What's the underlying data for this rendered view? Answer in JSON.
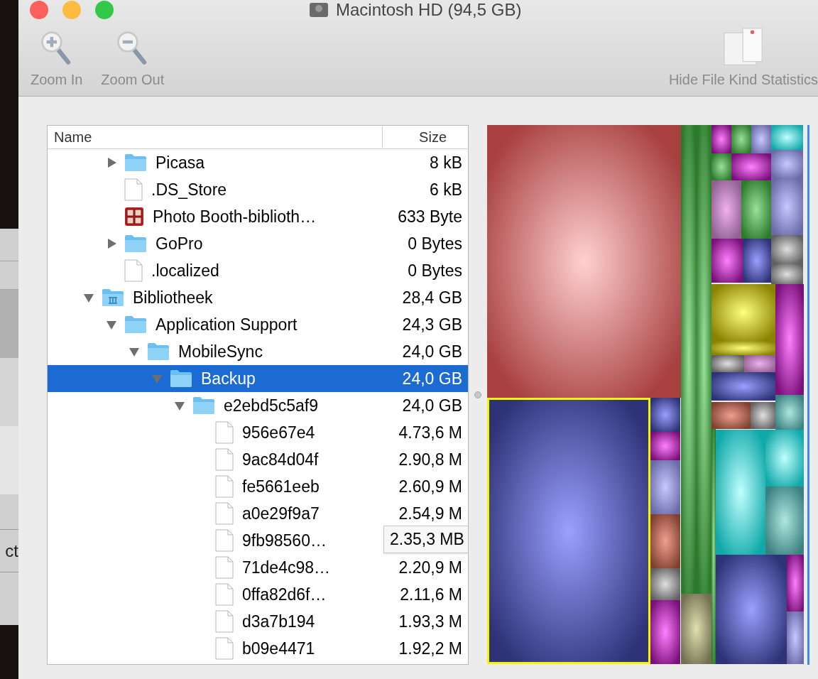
{
  "window": {
    "title": "Macintosh HD (94,5 GB)"
  },
  "background_window": {
    "text": "ct"
  },
  "toolbar": {
    "items": [
      {
        "kind": "zoom-in",
        "label": "Zoom In"
      },
      {
        "kind": "zoom-out",
        "label": "Zoom Out"
      }
    ],
    "right_item": {
      "label": "Hide File Kind Statistics"
    }
  },
  "table": {
    "columns": [
      "Name",
      "Size"
    ],
    "tree": [
      {
        "children": [
          {
            "name": "Picasa",
            "size": "8 kB",
            "kind": "folder",
            "expanded": false,
            "selected": false
          },
          {
            "name": ".DS_Store",
            "size": "6 kB",
            "kind": "document",
            "selected": false
          },
          {
            "name": "Photo Booth-biblioth…",
            "size": "633 Byte",
            "kind": "photo-library",
            "selected": false
          },
          {
            "name": "GoPro",
            "size": "0 Bytes",
            "kind": "folder",
            "expanded": false,
            "selected": false
          },
          {
            "name": ".localized",
            "size": "0 Bytes",
            "kind": "document",
            "selected": false
          }
        ]
      },
      {
        "name": "Bibliotheek",
        "size": "28,4 GB",
        "kind": "library-folder",
        "expanded": true,
        "selected": false,
        "children": [
          {
            "name": "Application Support",
            "size": "24,3 GB",
            "kind": "folder",
            "expanded": true,
            "selected": false,
            "children": [
              {
                "name": "MobileSync",
                "size": "24,0 GB",
                "kind": "folder",
                "expanded": true,
                "selected": false,
                "children": [
                  {
                    "name": "Backup",
                    "size": "24,0 GB",
                    "kind": "folder",
                    "expanded": true,
                    "selected": true,
                    "children": [
                      {
                        "name": "e2ebd5c5af9",
                        "size": "24,0 GB",
                        "kind": "folder",
                        "expanded": true,
                        "selected": false,
                        "children": [
                          {
                            "name": "956e67e4",
                            "size": "4.73,6 M",
                            "kind": "document",
                            "selected": false
                          },
                          {
                            "name": "9ac84d04f",
                            "size": "2.90,8 M",
                            "kind": "document",
                            "selected": false
                          },
                          {
                            "name": "fe5661eeb",
                            "size": "2.60,9 M",
                            "kind": "document",
                            "selected": false
                          },
                          {
                            "name": "a0e29f9a7",
                            "size": "2.54,9 M",
                            "kind": "document",
                            "selected": false
                          },
                          {
                            "name": "9fb98560…",
                            "tooltip": "2.35,3 MB",
                            "kind": "document",
                            "selected": false
                          },
                          {
                            "name": "71de4c98…",
                            "size": "2.20,9 M",
                            "kind": "document",
                            "selected": false
                          },
                          {
                            "name": "0ffa82d6f…",
                            "size": "2.11,6 M",
                            "kind": "document",
                            "selected": false
                          },
                          {
                            "name": "d3a7b194",
                            "size": "1.93,3 M",
                            "kind": "document",
                            "selected": false
                          },
                          {
                            "name": "b09e4471",
                            "size": "1.92,2 M",
                            "kind": "document",
                            "selected": false
                          }
                        ]
                      }
                    ]
                  }
                ]
              }
            ]
          }
        ]
      }
    ]
  }
}
